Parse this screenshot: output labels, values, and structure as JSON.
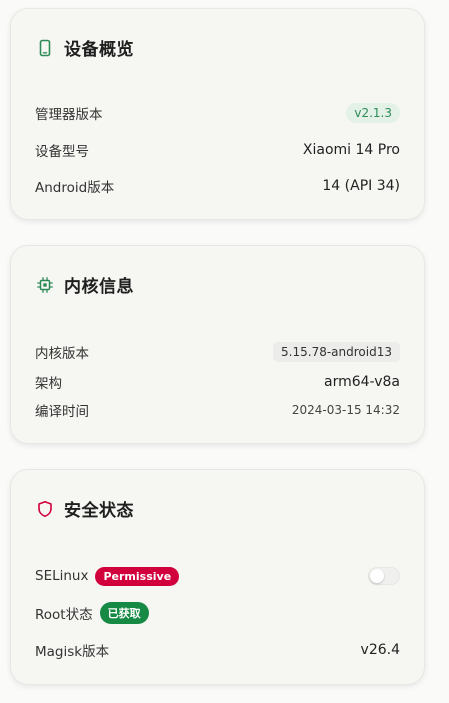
{
  "colors": {
    "accent_green": "#2e8b57",
    "accent_red": "#d1003d",
    "badge_green": "#168a45"
  },
  "device": {
    "icon": "phone-icon",
    "title": "设备概览",
    "manager_version_label": "管理器版本",
    "manager_version_value": "v2.1.3",
    "model_label": "设备型号",
    "model_value": "Xiaomi 14 Pro",
    "android_label": "Android版本",
    "android_value": "14 (API 34)"
  },
  "kernel": {
    "icon": "chip-icon",
    "title": "内核信息",
    "version_label": "内核版本",
    "version_value": "5.15.78-android13",
    "arch_label": "架构",
    "arch_value": "arm64-v8a",
    "build_time_label": "编译时间",
    "build_time_value": "2024-03-15 14:32"
  },
  "security": {
    "icon": "shield-icon",
    "title": "安全状态",
    "selinux_label": "SELinux",
    "selinux_badge": "Permissive",
    "selinux_enforcing": false,
    "root_label": "Root状态",
    "root_badge": "已获取",
    "magisk_label": "Magisk版本",
    "magisk_value": "v26.4"
  }
}
